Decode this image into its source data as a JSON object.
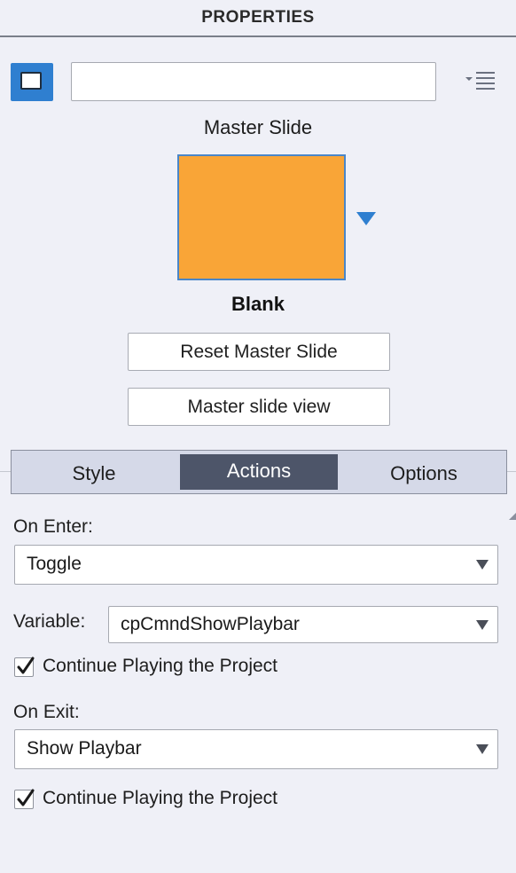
{
  "panel": {
    "title": "PROPERTIES"
  },
  "object": {
    "name_value": "",
    "icon": "slide-object-icon"
  },
  "menu": {
    "icon": "panel-menu-icon"
  },
  "master_slide": {
    "label": "Master Slide",
    "thumbnail_color": "#f9a537",
    "name": "Blank",
    "reset_label": "Reset Master Slide",
    "view_label": "Master slide view"
  },
  "tabs": [
    {
      "label": "Style",
      "active": false
    },
    {
      "label": "Actions",
      "active": true
    },
    {
      "label": "Options",
      "active": false
    }
  ],
  "actions": {
    "on_enter_label": "On Enter:",
    "on_enter_value": "Toggle",
    "variable_label": "Variable:",
    "variable_value": "cpCmndShowPlaybar",
    "continue_enter_label": "Continue Playing the Project",
    "continue_enter_checked": true,
    "on_exit_label": "On Exit:",
    "on_exit_value": "Show Playbar",
    "continue_exit_label": "Continue Playing the Project",
    "continue_exit_checked": true
  },
  "colors": {
    "accent_blue": "#2f7fd0",
    "active_tab": "#4d5569",
    "panel_bg": "#eff0f7"
  }
}
